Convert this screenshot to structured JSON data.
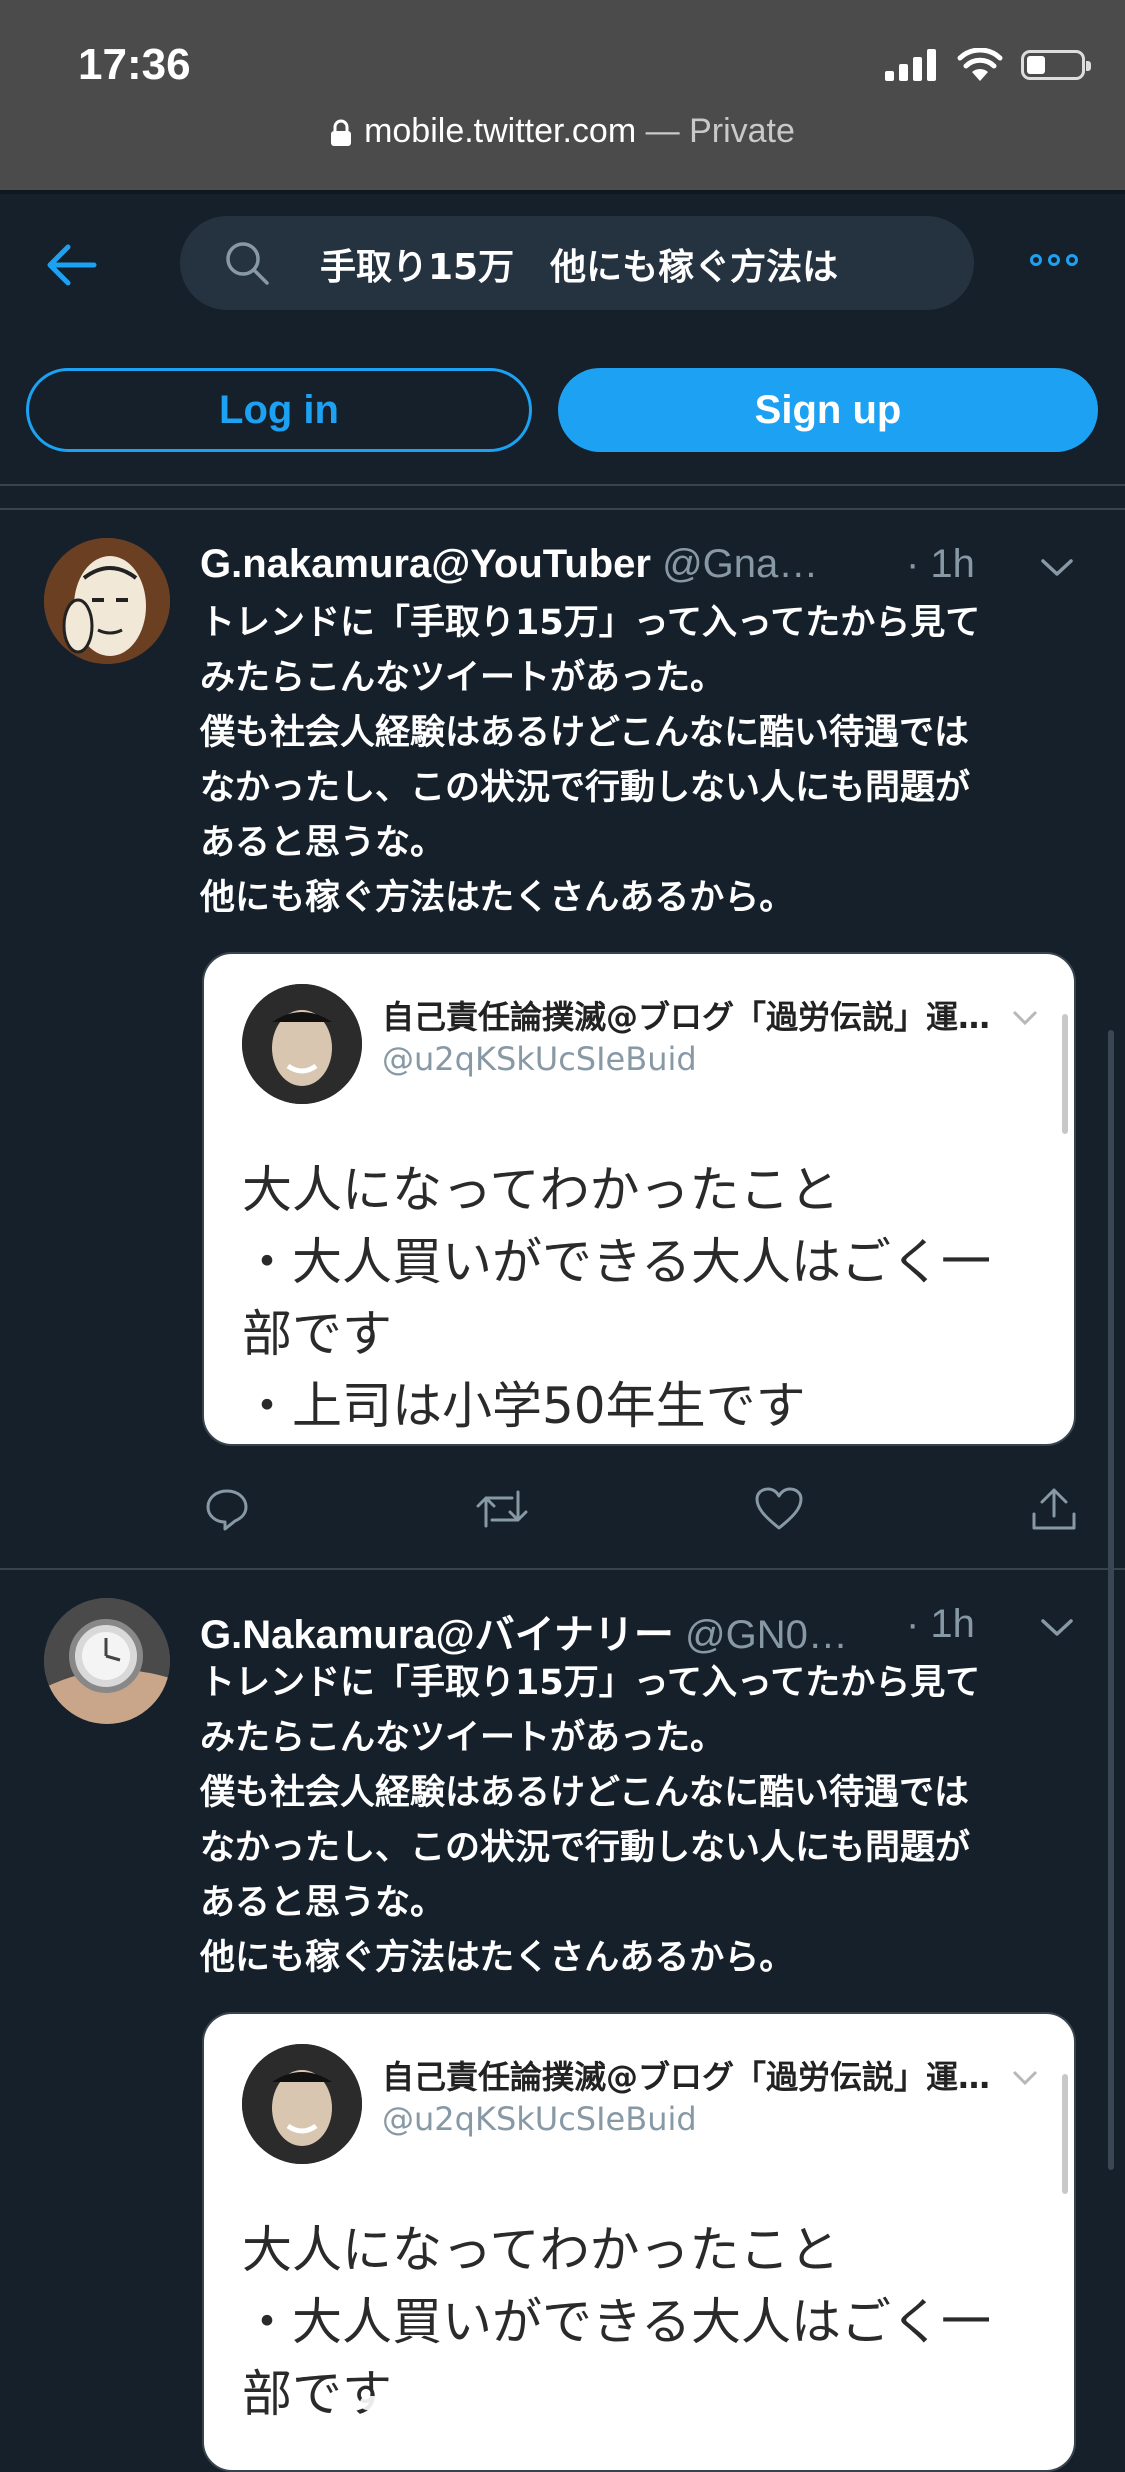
{
  "status": {
    "time": "17:36"
  },
  "browser": {
    "host": "mobile.twitter.com",
    "separator": " — ",
    "mode": "Private"
  },
  "search": {
    "query": "手取り15万　他にも稼ぐ方法は"
  },
  "auth": {
    "login_label": "Log in",
    "signup_label": "Sign up"
  },
  "colors": {
    "accent": "#1da1f2",
    "background": "#15202b",
    "card_bg": "#ffffff"
  },
  "tweets": [
    {
      "name": "G.nakamura@YouTuber",
      "handle": "@Gna…",
      "time": "· 1h",
      "lines": [
        "トレンドに「手取り15万」って入ってたから見て",
        "みたらこんなツイートがあった。",
        "僕も社会人経験はあるけどこんなに酷い待遇では",
        "なかったし、この状況で行動しない人にも問題が",
        "あると思うな。",
        "他にも稼ぐ方法はたくさんあるから。"
      ],
      "quote": {
        "name": "自己責任論撲滅@ブログ「過労伝説」運…",
        "handle": "@u2qKSkUcSIeBuid",
        "lines": [
          "大人になってわかったこと",
          "・大人買いができる大人はごく一",
          "部です",
          "・上司は小学50年生です"
        ]
      }
    },
    {
      "name": "G.Nakamura@バイナリー",
      "handle": "@GN0…",
      "time": "· 1h",
      "lines": [
        "トレンドに「手取り15万」って入ってたから見て",
        "みたらこんなツイートがあった。",
        "僕も社会人経験はあるけどこんなに酷い待遇では",
        "なかったし、この状況で行動しない人にも問題が",
        "あると思うな。",
        "他にも稼ぐ方法はたくさんあるから。"
      ],
      "quote": {
        "name": "自己責任論撲滅@ブログ「過労伝説」運…",
        "handle": "@u2qKSkUcSIeBuid",
        "lines": [
          "大人になってわかったこと",
          "・大人買いができる大人はごく一",
          "部です"
        ]
      }
    }
  ]
}
